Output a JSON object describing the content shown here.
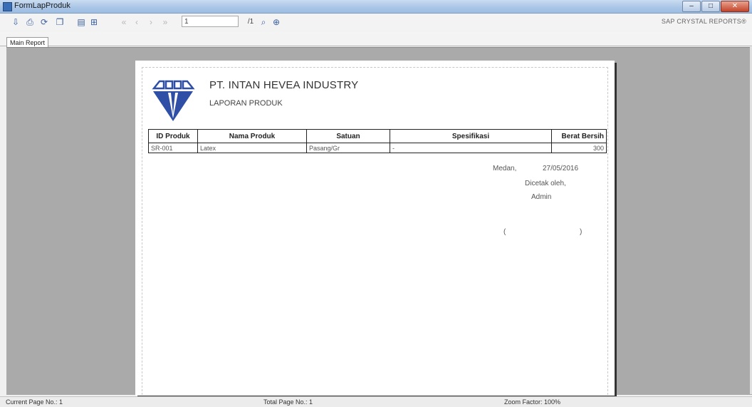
{
  "window": {
    "title": "FormLapProduk",
    "minimize": "–",
    "maximize": "□",
    "close": "✕"
  },
  "toolbar": {
    "icons": [
      "export-icon",
      "print-icon",
      "refresh-icon",
      "copy-icon",
      "toggle-tree-icon",
      "group-tree-icon"
    ],
    "page_input_value": "1",
    "page_of": "/1",
    "sap_label": "SAP CRYSTAL REPORTS®"
  },
  "tabs": [
    {
      "label": "Main Report"
    }
  ],
  "report": {
    "company": "PT. INTAN HEVEA INDUSTRY",
    "title": "LAPORAN PRODUK",
    "columns": [
      "ID Produk",
      "Nama Produk",
      "Satuan",
      "Spesifikasi",
      "Berat Bersih"
    ],
    "rows": [
      [
        "SR-001",
        "Latex",
        "Pasang/Gr",
        "-",
        "300"
      ]
    ],
    "signature": {
      "city": "Medan,",
      "date": "27/05/2016",
      "printed_by": "Dicetak oleh,",
      "name": "Admin",
      "open_paren": "(",
      "close_paren": ")"
    }
  },
  "status": {
    "current_page": "Current Page No.: 1",
    "total_page": "Total Page No.: 1",
    "zoom": "Zoom Factor: 100%"
  },
  "colors": {
    "logo_blue": "#2f4fa6",
    "viewer_bg": "#aaaaaa",
    "titlebar": "#a9c5e6"
  }
}
